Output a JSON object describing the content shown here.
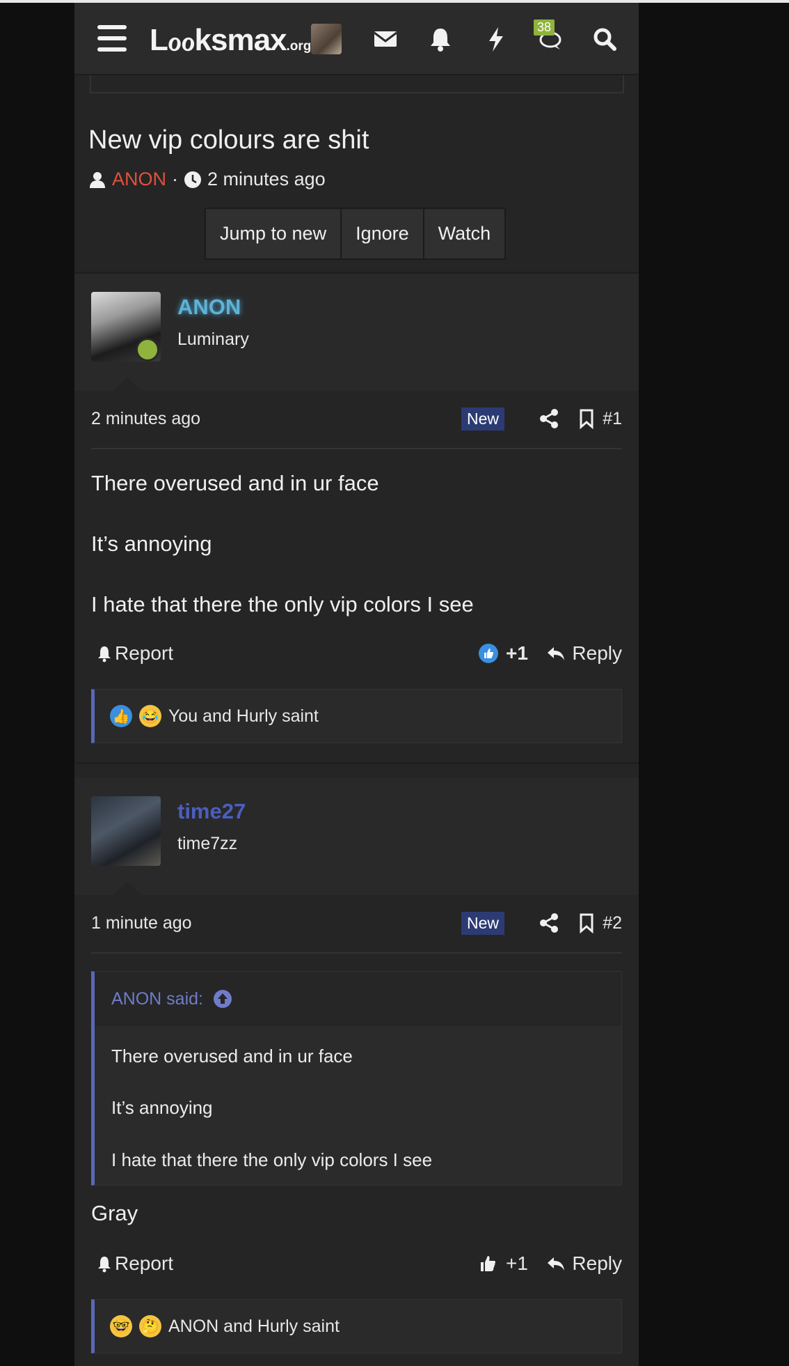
{
  "header": {
    "logo_main": "Lℴℴksmax",
    "logo_org": ".org",
    "badge_count": "38"
  },
  "thread": {
    "title": "New vip colours are shit",
    "author": "ANON",
    "separator": "·",
    "time": "2 minutes ago",
    "buttons": [
      "Jump to new",
      "Ignore",
      "Watch"
    ]
  },
  "posts": [
    {
      "username": "ANON",
      "rank": "Luminary",
      "time": "2 minutes ago",
      "new_label": "New",
      "number": "#1",
      "lines": [
        "There overused and in ur face",
        "It’s annoying",
        "I hate that there the only vip colors I see"
      ],
      "report": "Report",
      "like_count": "+1",
      "reply": "Reply",
      "reactions_text": "You and Hurly saint"
    },
    {
      "username": "time27",
      "rank": "time7zz",
      "time": "1 minute ago",
      "new_label": "New",
      "number": "#2",
      "quote_head": "ANON said:",
      "quote_lines": [
        "There overused and in ur face",
        "It’s annoying",
        "I hate that there the only vip colors I see"
      ],
      "lines": [
        "Gray"
      ],
      "report": "Report",
      "like_count": "+1",
      "reply": "Reply",
      "reactions_text": "ANON and Hurly saint"
    }
  ],
  "colors": {
    "background": "#0f0f0f",
    "panel": "#252525",
    "author_red": "#e2503e",
    "anon_blue": "#5fb2d6",
    "time27_blue": "#4b5fc0",
    "accent": "#5a68b8",
    "online": "#8fb33c",
    "new_badge": "#2d3b74"
  },
  "icons": [
    "menu-icon",
    "envelope-icon",
    "bell-icon",
    "bolt-icon",
    "chat-icon",
    "search-icon",
    "user-icon",
    "clock-icon",
    "share-icon",
    "bookmark-icon",
    "like-icon",
    "reply-icon",
    "arrow-up-circle-icon"
  ]
}
